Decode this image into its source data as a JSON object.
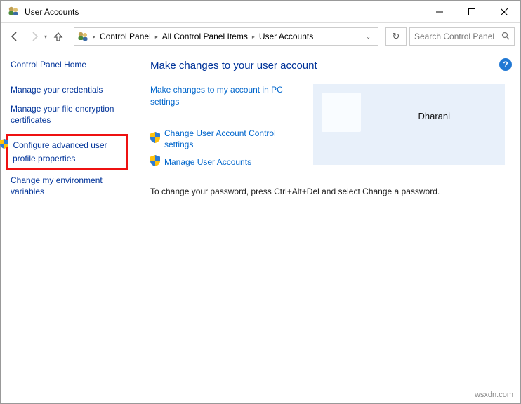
{
  "window": {
    "title": "User Accounts"
  },
  "breadcrumb": {
    "items": [
      "Control Panel",
      "All Control Panel Items",
      "User Accounts"
    ]
  },
  "search": {
    "placeholder": "Search Control Panel"
  },
  "sidebar": {
    "home": "Control Panel Home",
    "links": [
      "Manage your credentials",
      "Manage your file encryption certificates",
      "Configure advanced user profile properties",
      "Change my environment variables"
    ]
  },
  "main": {
    "heading": "Make changes to your user account",
    "actions": {
      "pc_settings": "Make changes to my account in PC settings",
      "uac": "Change User Account Control settings",
      "manage": "Manage User Accounts"
    },
    "user_name": "Dharani",
    "instruction": "To change your password, press Ctrl+Alt+Del and select Change a password."
  },
  "watermark": "wsxdn.com"
}
